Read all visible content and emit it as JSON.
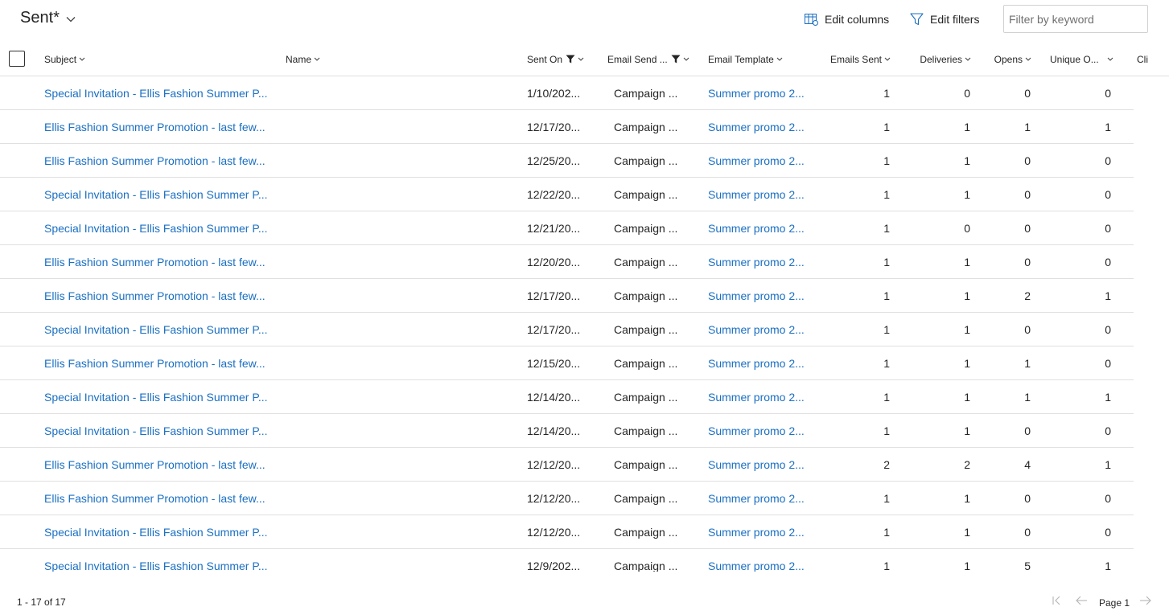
{
  "header": {
    "view_title": "Sent*",
    "edit_columns_label": "Edit columns",
    "edit_filters_label": "Edit filters",
    "filter_placeholder": "Filter by keyword"
  },
  "columns": {
    "subject": "Subject",
    "name": "Name",
    "sent_on": "Sent On",
    "email_send_type": "Email Send ...",
    "email_template": "Email Template",
    "emails_sent": "Emails Sent",
    "deliveries": "Deliveries",
    "opens": "Opens",
    "unique_opens": "Unique O...",
    "clicks": "Cli"
  },
  "rows": [
    {
      "subject": "Special Invitation - Ellis Fashion Summer P...",
      "name": "",
      "sent_on": "1/10/202...",
      "type": "Campaign ...",
      "template": "Summer promo 2...",
      "emails_sent": "1",
      "deliveries": "0",
      "opens": "0",
      "unique_opens": "0"
    },
    {
      "subject": "Ellis Fashion Summer Promotion - last few...",
      "name": "",
      "sent_on": "12/17/20...",
      "type": "Campaign ...",
      "template": "Summer promo 2...",
      "emails_sent": "1",
      "deliveries": "1",
      "opens": "1",
      "unique_opens": "1"
    },
    {
      "subject": "Ellis Fashion Summer Promotion - last few...",
      "name": "",
      "sent_on": "12/25/20...",
      "type": "Campaign ...",
      "template": "Summer promo 2...",
      "emails_sent": "1",
      "deliveries": "1",
      "opens": "0",
      "unique_opens": "0"
    },
    {
      "subject": "Special Invitation - Ellis Fashion Summer P...",
      "name": "",
      "sent_on": "12/22/20...",
      "type": "Campaign ...",
      "template": "Summer promo 2...",
      "emails_sent": "1",
      "deliveries": "1",
      "opens": "0",
      "unique_opens": "0"
    },
    {
      "subject": "Special Invitation - Ellis Fashion Summer P...",
      "name": "",
      "sent_on": "12/21/20...",
      "type": "Campaign ...",
      "template": "Summer promo 2...",
      "emails_sent": "1",
      "deliveries": "0",
      "opens": "0",
      "unique_opens": "0"
    },
    {
      "subject": "Ellis Fashion Summer Promotion - last few...",
      "name": "",
      "sent_on": "12/20/20...",
      "type": "Campaign ...",
      "template": "Summer promo 2...",
      "emails_sent": "1",
      "deliveries": "1",
      "opens": "0",
      "unique_opens": "0"
    },
    {
      "subject": "Ellis Fashion Summer Promotion - last few...",
      "name": "",
      "sent_on": "12/17/20...",
      "type": "Campaign ...",
      "template": "Summer promo 2...",
      "emails_sent": "1",
      "deliveries": "1",
      "opens": "2",
      "unique_opens": "1"
    },
    {
      "subject": "Special Invitation - Ellis Fashion Summer P...",
      "name": "",
      "sent_on": "12/17/20...",
      "type": "Campaign ...",
      "template": "Summer promo 2...",
      "emails_sent": "1",
      "deliveries": "1",
      "opens": "0",
      "unique_opens": "0"
    },
    {
      "subject": "Ellis Fashion Summer Promotion - last few...",
      "name": "",
      "sent_on": "12/15/20...",
      "type": "Campaign ...",
      "template": "Summer promo 2...",
      "emails_sent": "1",
      "deliveries": "1",
      "opens": "1",
      "unique_opens": "0"
    },
    {
      "subject": "Special Invitation - Ellis Fashion Summer P...",
      "name": "",
      "sent_on": "12/14/20...",
      "type": "Campaign ...",
      "template": "Summer promo 2...",
      "emails_sent": "1",
      "deliveries": "1",
      "opens": "1",
      "unique_opens": "1"
    },
    {
      "subject": "Special Invitation - Ellis Fashion Summer P...",
      "name": "",
      "sent_on": "12/14/20...",
      "type": "Campaign ...",
      "template": "Summer promo 2...",
      "emails_sent": "1",
      "deliveries": "1",
      "opens": "0",
      "unique_opens": "0"
    },
    {
      "subject": "Ellis Fashion Summer Promotion - last few...",
      "name": "",
      "sent_on": "12/12/20...",
      "type": "Campaign ...",
      "template": "Summer promo 2...",
      "emails_sent": "2",
      "deliveries": "2",
      "opens": "4",
      "unique_opens": "1"
    },
    {
      "subject": "Ellis Fashion Summer Promotion - last few...",
      "name": "",
      "sent_on": "12/12/20...",
      "type": "Campaign ...",
      "template": "Summer promo 2...",
      "emails_sent": "1",
      "deliveries": "1",
      "opens": "0",
      "unique_opens": "0"
    },
    {
      "subject": "Special Invitation - Ellis Fashion Summer P...",
      "name": "",
      "sent_on": "12/12/20...",
      "type": "Campaign ...",
      "template": "Summer promo 2...",
      "emails_sent": "1",
      "deliveries": "1",
      "opens": "0",
      "unique_opens": "0"
    },
    {
      "subject": "Special Invitation - Ellis Fashion Summer P...",
      "name": "",
      "sent_on": "12/9/202...",
      "type": "Campaign ...",
      "template": "Summer promo 2...",
      "emails_sent": "1",
      "deliveries": "1",
      "opens": "5",
      "unique_opens": "1"
    }
  ],
  "footer": {
    "record_count": "1 - 17 of 17",
    "page_label": "Page 1"
  },
  "colors": {
    "link": "#1a6fc2",
    "text": "#242424",
    "border": "#e0e0e0"
  }
}
